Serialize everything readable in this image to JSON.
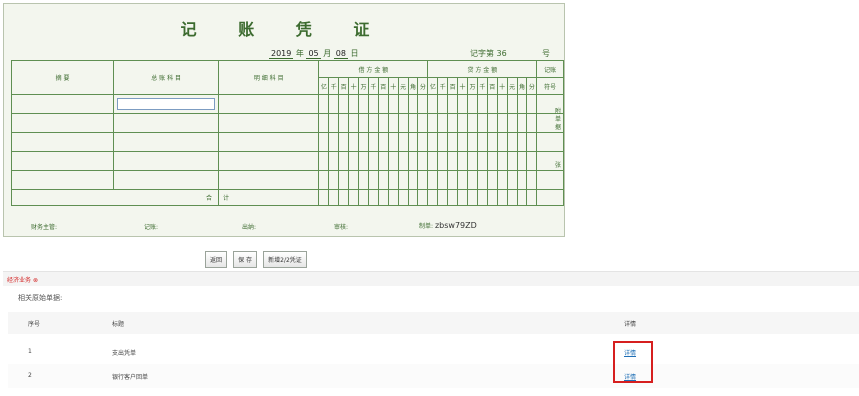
{
  "voucher": {
    "title": "记 账 凭 证",
    "date_year": "2019",
    "date_y_label": "年",
    "date_month": "05",
    "date_m_label": "月",
    "date_day": "08",
    "date_d_label": "日",
    "voucher_no_label": "记字第",
    "voucher_no": "36",
    "hao_label": "号",
    "headers": {
      "summary": "摘 要",
      "general_account": "总 账 科 目",
      "detail_account": "明 细 科 目",
      "debit": "借 方 金 额",
      "credit": "贷 方 金 额",
      "posted_top": "记账",
      "posted_bottom": "符号"
    },
    "digit_units": [
      "亿",
      "千",
      "百",
      "十",
      "万",
      "千",
      "百",
      "十",
      "元",
      "角",
      "分"
    ],
    "total_left": "合",
    "total_right": "计",
    "attach_label": "附单据",
    "zhang_label": "张",
    "footer": {
      "finance_manager": "财务主管:",
      "bookkeeper": "记账:",
      "cashier": "出纳:",
      "auditor": "审核:",
      "maker": "制单:",
      "maker_value": "zbsw79ZD"
    }
  },
  "buttons": {
    "back": "返回",
    "save": "保 存",
    "new": "新增2/2凭证"
  },
  "tab": {
    "label": "经济业务",
    "close": "⊗"
  },
  "section": {
    "title": "相关原始单据:"
  },
  "table": {
    "columns": [
      "序号",
      "标题",
      "详情"
    ],
    "rows": [
      {
        "no": "1",
        "title": "支出凭单",
        "detail": "详情"
      },
      {
        "no": "2",
        "title": "银行客户回单",
        "detail": "详情"
      }
    ]
  }
}
